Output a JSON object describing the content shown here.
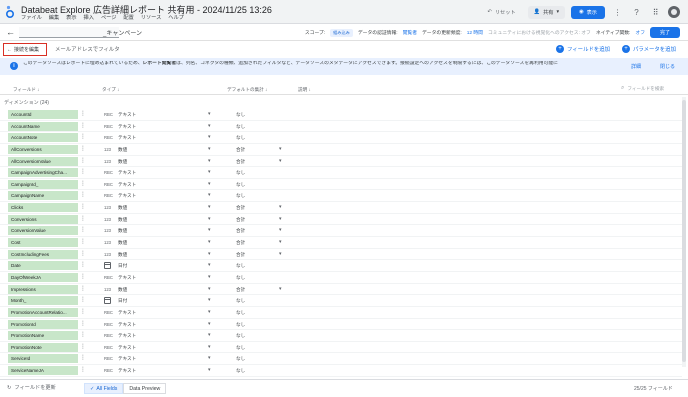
{
  "app": {
    "title": "Databeat Explore 広告詳細レポート 共有用 - 2024/11/25 13:26",
    "menu": [
      "ファイル",
      "編集",
      "表示",
      "挿入",
      "ページ",
      "配置",
      "リソース",
      "ヘルプ"
    ],
    "reset_label": "リセット",
    "share_label": "共有",
    "view_label": "表示",
    "accent": "#1a73e8"
  },
  "datasource": {
    "name": "_キャンペーン",
    "scope_label": "スコープ:",
    "scope_value": "組み込み",
    "cred_label": "データの認証情報:",
    "cred_value": "閲覧者",
    "freshness_label": "データの更新頻度:",
    "freshness_value": "12 時間",
    "community_label": "コミュニティにおける視覚化へのアクセス: オフ",
    "native_label": "ネイティブ関数:",
    "native_value": "オフ",
    "done_label": "完了"
  },
  "toolbar": {
    "edit_connection": "接続を編集",
    "email_filter": "メールアドレスでフィルタ",
    "add_field": "フィールドを追加",
    "add_param": "パラメータを追加"
  },
  "banner": {
    "text_pre": "このデータソースはレポートに埋め込まれているため、",
    "text_bold": "レポート閲覧者",
    "text_post": "は、列名、コネクタの種類、追加されたフィルタなど、データソースのメタデータにアクセスできます。接続設定へのアクセスを制限するには、このデータソースを再利用可能に",
    "details": "詳細",
    "close": "閉じる"
  },
  "columns": {
    "field": "フィールド",
    "type": "タイプ",
    "default_agg": "デフォルトの集計",
    "description": "説明",
    "search_placeholder": "フィールドを検索"
  },
  "dimension_label": "ディメンション (24)",
  "rows": [
    {
      "name": "AccountId",
      "type_icon": "RBC",
      "type": "テキスト",
      "agg": "なし",
      "agg_drop": false
    },
    {
      "name": "AccountName",
      "type_icon": "RBC",
      "type": "テキスト",
      "agg": "なし",
      "agg_drop": false
    },
    {
      "name": "AccountNote",
      "type_icon": "RBC",
      "type": "テキスト",
      "agg": "なし",
      "agg_drop": false
    },
    {
      "name": "AllConversions",
      "type_icon": "123",
      "type": "数値",
      "agg": "合計",
      "agg_drop": true
    },
    {
      "name": "AllConversionValue",
      "type_icon": "123",
      "type": "数値",
      "agg": "合計",
      "agg_drop": true
    },
    {
      "name": "CampaignAdvertisingCha...",
      "type_icon": "RBC",
      "type": "テキスト",
      "agg": "なし",
      "agg_drop": false
    },
    {
      "name": "CampaignId_",
      "type_icon": "RBC",
      "type": "テキスト",
      "agg": "なし",
      "agg_drop": false
    },
    {
      "name": "CampaignName",
      "type_icon": "RBC",
      "type": "テキスト",
      "agg": "なし",
      "agg_drop": false
    },
    {
      "name": "Clicks",
      "type_icon": "123",
      "type": "数値",
      "agg": "合計",
      "agg_drop": true
    },
    {
      "name": "Conversions",
      "type_icon": "123",
      "type": "数値",
      "agg": "合計",
      "agg_drop": true
    },
    {
      "name": "ConversionValue",
      "type_icon": "123",
      "type": "数値",
      "agg": "合計",
      "agg_drop": true
    },
    {
      "name": "Cost",
      "type_icon": "123",
      "type": "数値",
      "agg": "合計",
      "agg_drop": true
    },
    {
      "name": "CostIncludingFees",
      "type_icon": "123",
      "type": "数値",
      "agg": "合計",
      "agg_drop": true
    },
    {
      "name": "Date",
      "type_icon": "calendar",
      "type": "日付",
      "agg": "なし",
      "agg_drop": false
    },
    {
      "name": "DayOfWeekJA",
      "type_icon": "RBC",
      "type": "テキスト",
      "agg": "なし",
      "agg_drop": false
    },
    {
      "name": "Impressions",
      "type_icon": "123",
      "type": "数値",
      "agg": "合計",
      "agg_drop": true
    },
    {
      "name": "Month_",
      "type_icon": "calendar",
      "type": "日付",
      "agg": "なし",
      "agg_drop": false
    },
    {
      "name": "PromotionAccountRelatio...",
      "type_icon": "RBC",
      "type": "テキスト",
      "agg": "なし",
      "agg_drop": false
    },
    {
      "name": "PromotionId",
      "type_icon": "RBC",
      "type": "テキスト",
      "agg": "なし",
      "agg_drop": false
    },
    {
      "name": "PromotionName",
      "type_icon": "RBC",
      "type": "テキスト",
      "agg": "なし",
      "agg_drop": false
    },
    {
      "name": "PromotionNote",
      "type_icon": "RBC",
      "type": "テキスト",
      "agg": "なし",
      "agg_drop": false
    },
    {
      "name": "ServiceId",
      "type_icon": "RBC",
      "type": "テキスト",
      "agg": "なし",
      "agg_drop": false
    },
    {
      "name": "ServiceNameJA",
      "type_icon": "RBC",
      "type": "テキスト",
      "agg": "なし",
      "agg_drop": false
    }
  ],
  "footer": {
    "refresh": "フィールドを更新",
    "tab_all": "All Fields",
    "tab_preview": "Data Preview",
    "count": "25/25 フィールド"
  }
}
